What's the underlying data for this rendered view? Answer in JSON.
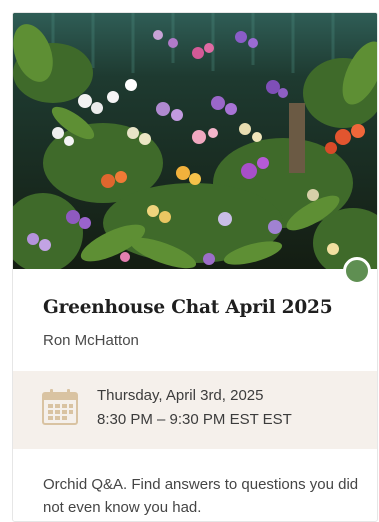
{
  "event": {
    "title": "Greenhouse Chat April 2025",
    "host": "Ron McHatton",
    "date": "Thursday, April 3rd, 2025",
    "time": "8:30 PM – 9:30 PM EST EST",
    "description": "Orchid Q&A. Find answers to questions you did not even know you had."
  },
  "icons": {
    "calendar": "calendar-icon",
    "status": "status-dot"
  },
  "colors": {
    "status_dot": "#5f8f52",
    "date_band": "#f5f0eb",
    "calendar_icon": "#d9c3a2"
  }
}
